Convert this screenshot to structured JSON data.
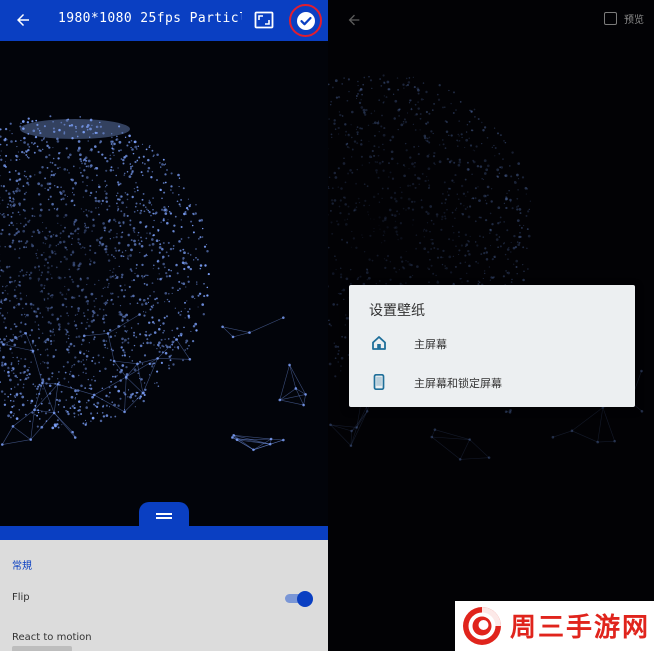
{
  "left_screen": {
    "header": {
      "title": "1980*1080 25fps Particl···",
      "back_icon": "arrow-left-icon",
      "crop_icon": "crop-frame-icon",
      "apply_icon": "check-circle-icon"
    },
    "settings_sheet": {
      "section_title": "常規",
      "flip_label": "Flip",
      "flip_enabled": true,
      "motion_label": "React to motion"
    }
  },
  "right_screen": {
    "preview_label": "预览",
    "preview_checked": false,
    "dialog": {
      "title": "设置壁纸",
      "options": [
        {
          "label": "主屏幕",
          "icon": "home-icon"
        },
        {
          "label": "主屏幕和锁定屏幕",
          "icon": "phone-icon"
        }
      ]
    }
  },
  "watermark": {
    "text": "周三手游网"
  },
  "colors": {
    "accent": "#0a3fc2",
    "highlight_ring": "#e21d2f",
    "dialog_icon": "#1f6f9a",
    "watermark_red": "#e0241c"
  }
}
